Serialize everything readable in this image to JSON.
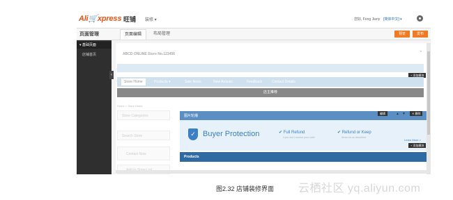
{
  "header": {
    "logo_prefix": "Ali",
    "logo_suffix": "xpress",
    "brand": "旺铺",
    "nav_dropdown": "装修 ▾",
    "user": "您好, Feng Jiany",
    "language": "[简体中文] ▾"
  },
  "subnav": {
    "title": "页面管理",
    "tabs": [
      "页面编辑",
      "布局管理"
    ],
    "preview_label": "预览",
    "publish_label": "发布"
  },
  "sidebar": {
    "section": "▾ 基础页面",
    "items": [
      "店铺首页"
    ],
    "toggle": "‹"
  },
  "editor": {
    "store_name": "ABCD ONLINE  Store No.123456",
    "close": "×",
    "add_module_label": "+ 添加模块",
    "menu_items": [
      "Store Home",
      "Products ▾",
      "Sale Items",
      "New Arrivals",
      "Feedback",
      "Contact Details"
    ],
    "banner_bar": "店主推荐",
    "breadcrumb": "Home > Store Home",
    "left_boxes": [
      "Store Categories",
      "Search Store",
      "Contact Now",
      "Add to Store List"
    ],
    "panel_title": "图片轮播",
    "panel_actions": [
      "编辑",
      "✕ 删除"
    ]
  },
  "buyer_protection": {
    "title": "Buyer Protection",
    "feature1": "✔ Full Refund",
    "feature1_sub": "if you don't receive your order",
    "feature2": "✔ Refund or Keep",
    "feature2_sub": "items not as described",
    "learn_more": "Learn More >"
  },
  "products_label": "Products",
  "caption": "图2.32    店铺装修界面",
  "watermark": "云栖社区 yq.aliyun.com",
  "colors": {
    "accent": "#f07b22",
    "brand_blue": "#3b7fc4"
  }
}
